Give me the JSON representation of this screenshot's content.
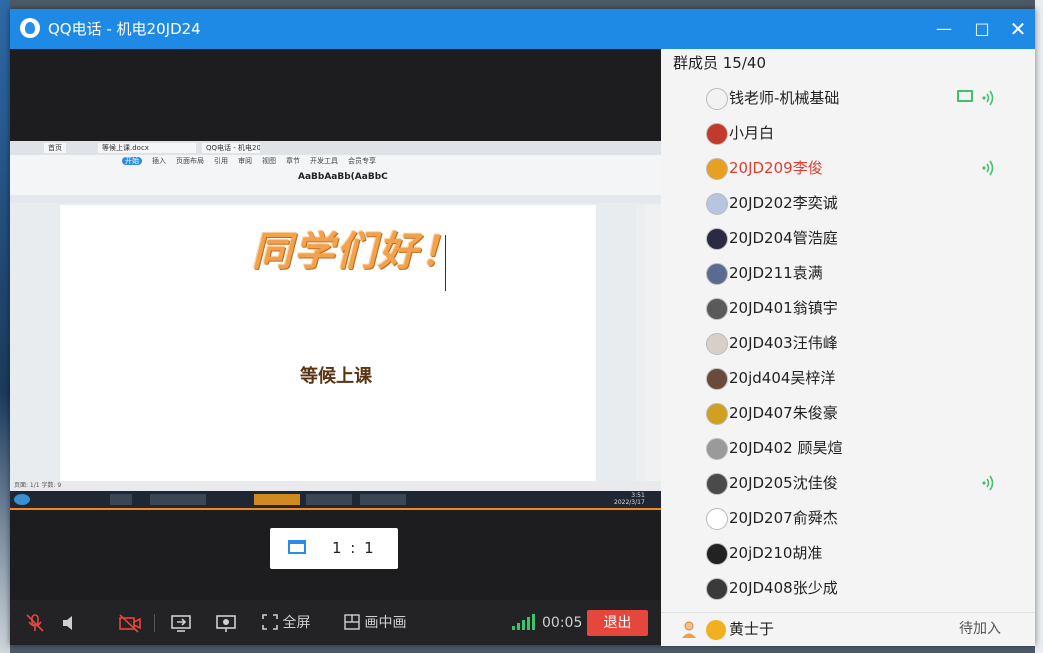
{
  "window": {
    "title": "QQ电话 - 机电20JD24"
  },
  "shared_doc": {
    "tabs": [
      "首页",
      "等候上课.docx",
      "QQ电话 - 机电20JD24"
    ],
    "ribbon_tabs": [
      "开始",
      "插入",
      "页面布局",
      "引用",
      "审阅",
      "视图",
      "章节",
      "开发工具",
      "会员专享"
    ],
    "styles_preview": "AaBbAaBb(AaBbC",
    "greeting": "同学们好！",
    "subtitle": "等候上课",
    "status_left": "页面: 1/1  字数: 9",
    "time": "3:51",
    "date": "2022/3/17"
  },
  "ratio_button": {
    "label": "1 : 1"
  },
  "controls": {
    "fullscreen_label": "全屏",
    "pip_label": "画中画",
    "call_time": "00:05",
    "exit_label": "退出"
  },
  "members": {
    "header": "群成员 15/40",
    "list": [
      {
        "name": "钱老师-机械基础",
        "speaking": false,
        "voice": true,
        "screen": true,
        "avatar_color": "#f2f2f2"
      },
      {
        "name": "小月白",
        "speaking": false,
        "voice": false,
        "screen": false,
        "avatar_color": "#c23a2a"
      },
      {
        "name": "20JD209李俊",
        "speaking": true,
        "voice": true,
        "screen": false,
        "avatar_color": "#e8a020"
      },
      {
        "name": "20JD202李奕诚",
        "speaking": false,
        "voice": false,
        "screen": false,
        "avatar_color": "#b8c4e0"
      },
      {
        "name": "20JD204管浩庭",
        "speaking": false,
        "voice": false,
        "screen": false,
        "avatar_color": "#2a2a40"
      },
      {
        "name": "20JD211袁满",
        "speaking": false,
        "voice": false,
        "screen": false,
        "avatar_color": "#5a6a90"
      },
      {
        "name": "20JD401翁镇宇",
        "speaking": false,
        "voice": false,
        "screen": false,
        "avatar_color": "#5a5a5a"
      },
      {
        "name": "20JD403汪伟峰",
        "speaking": false,
        "voice": false,
        "screen": false,
        "avatar_color": "#d8d0c8"
      },
      {
        "name": "20jd404吴梓洋",
        "speaking": false,
        "voice": false,
        "screen": false,
        "avatar_color": "#6a4a3a"
      },
      {
        "name": "20JD407朱俊豪",
        "speaking": false,
        "voice": false,
        "screen": false,
        "avatar_color": "#d0a020"
      },
      {
        "name": "20JD402 顾昊煊",
        "speaking": false,
        "voice": false,
        "screen": false,
        "avatar_color": "#9a9a9a"
      },
      {
        "name": "20JD205沈佳俊",
        "speaking": false,
        "voice": true,
        "screen": false,
        "avatar_color": "#4a4a4a"
      },
      {
        "name": "20JD207俞舜杰",
        "speaking": false,
        "voice": false,
        "screen": false,
        "avatar_color": "#ffffff"
      },
      {
        "name": "20jD210胡准",
        "speaking": false,
        "voice": false,
        "screen": false,
        "avatar_color": "#222222"
      },
      {
        "name": "20JD408张少成",
        "speaking": false,
        "voice": false,
        "screen": false,
        "avatar_color": "#3a3a3a"
      }
    ],
    "pending": {
      "name": "黄士于",
      "status": "待加入",
      "avatar_color": "#f0b020"
    }
  },
  "colors": {
    "titlebar": "#1f8ae6",
    "speaking": "#e33b2f",
    "voice": "#3fc26a",
    "exit": "#e5473d"
  },
  "icons": [
    "qq-logo-icon",
    "mic-muted-icon",
    "speaker-icon",
    "camera-off-icon",
    "share-screen-icon",
    "beauty-camera-icon",
    "fullscreen-icon",
    "pip-icon",
    "signal-icon",
    "voice-icon",
    "screen-share-icon",
    "person-icon"
  ]
}
